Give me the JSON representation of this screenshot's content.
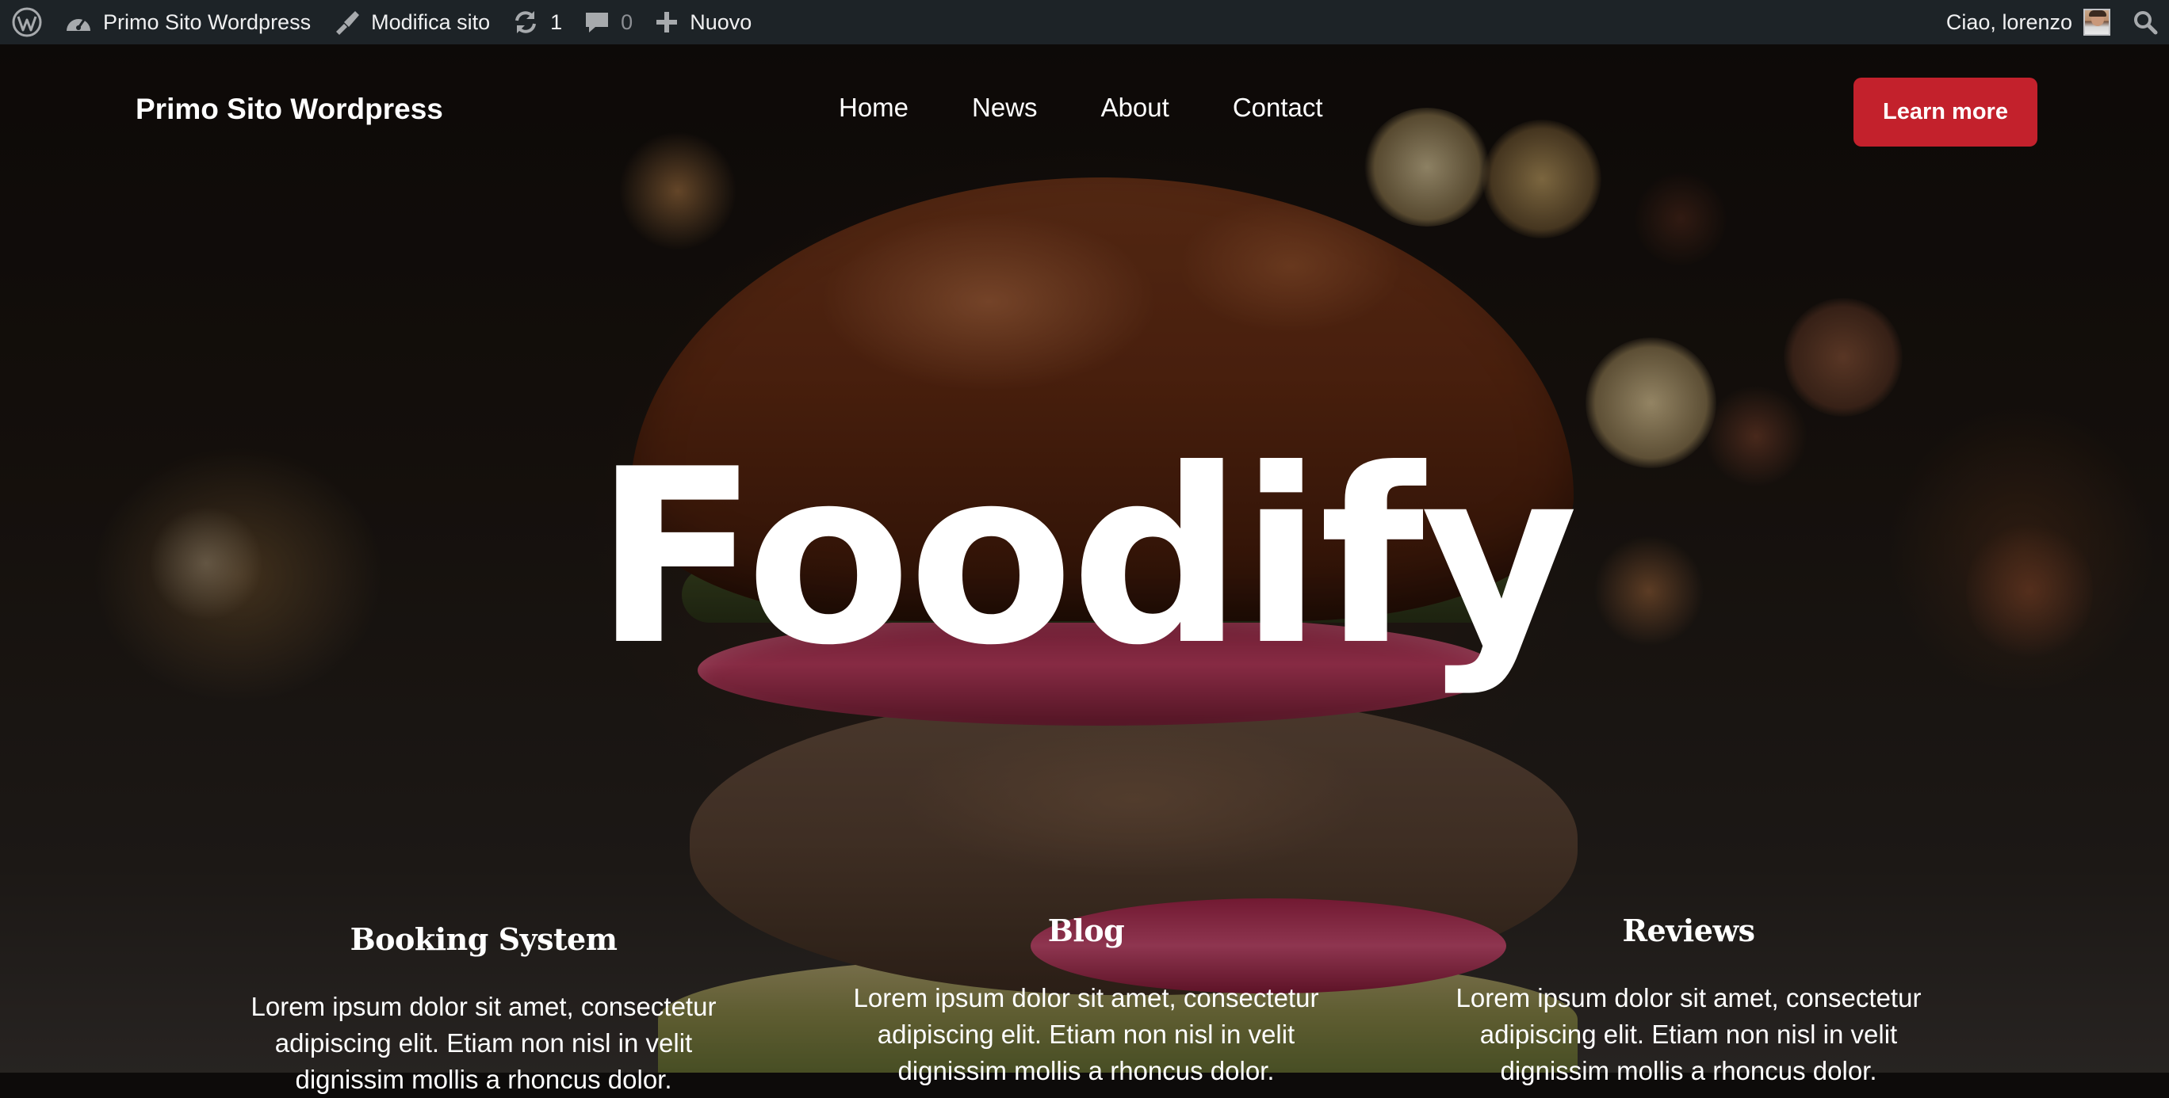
{
  "admin_bar": {
    "wp_logo_icon": "wordpress-logo-icon",
    "site_name": "Primo Sito Wordpress",
    "edit_site": "Modifica sito",
    "updates_count": "1",
    "comments_count": "0",
    "new_label": "Nuovo",
    "greeting": "Ciao, lorenzo"
  },
  "header": {
    "site_title": "Primo Sito Wordpress",
    "nav": [
      "Home",
      "News",
      "About",
      "Contact"
    ],
    "cta_label": "Learn more",
    "cta_color": "#c3212c"
  },
  "hero": {
    "title": "Foodify"
  },
  "features": [
    {
      "title": "Booking System",
      "text": "Lorem ipsum dolor sit amet, consectetur adipiscing elit. Etiam non nisl in velit dignissim mollis a rhoncus dolor."
    },
    {
      "title": "Blog",
      "text": "Lorem ipsum dolor sit amet, consectetur adipiscing elit. Etiam non nisl in velit dignissim mollis a rhoncus dolor."
    },
    {
      "title": "Reviews",
      "text": "Lorem ipsum dolor sit amet, consectetur adipiscing elit. Etiam non nisl in velit dignissim mollis a rhoncus dolor."
    }
  ],
  "colors": {
    "admin_bar_bg": "#1d2327",
    "admin_bar_text": "#f0f0f1",
    "muted": "#8c8f94"
  }
}
